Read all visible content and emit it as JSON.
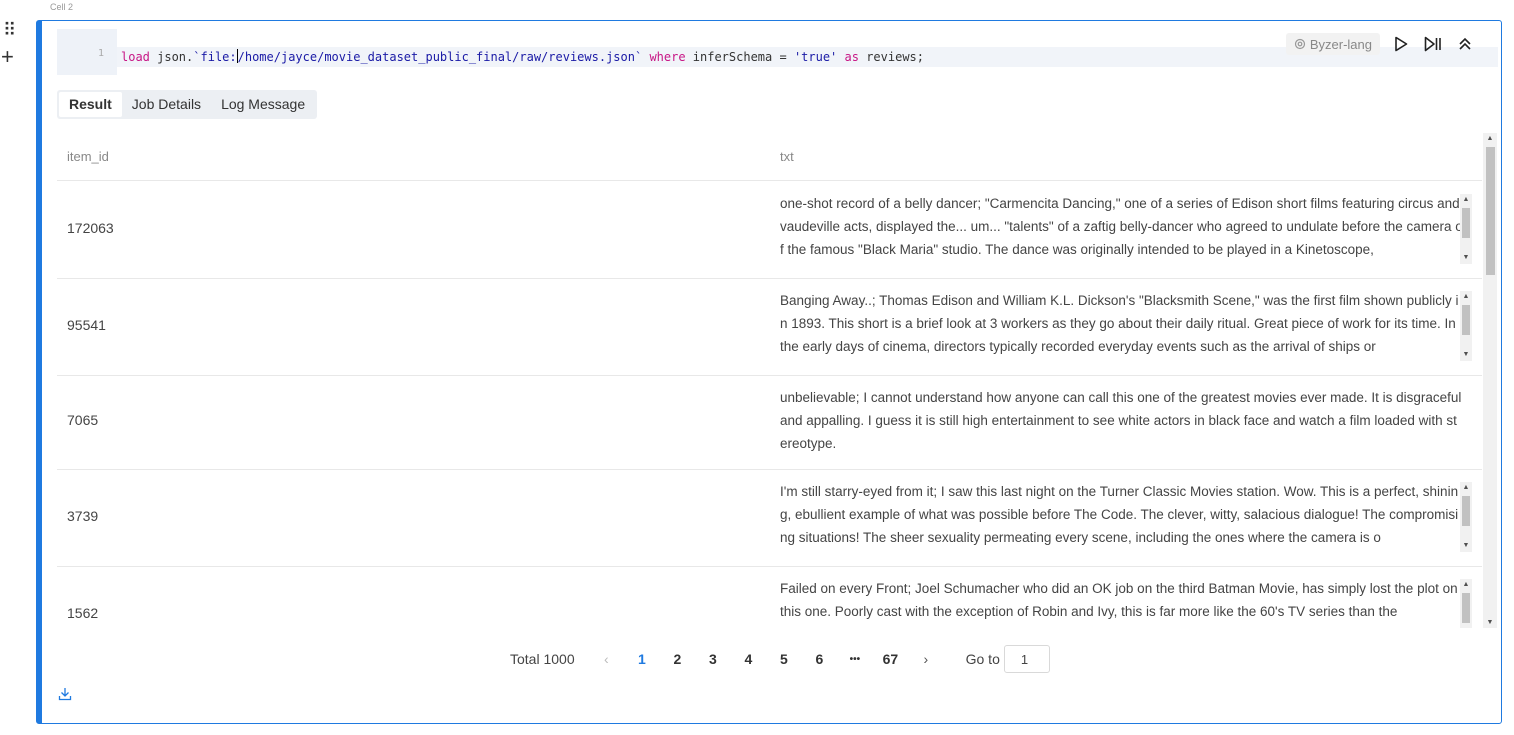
{
  "cell": {
    "label": "Cell 2",
    "drag_glyph": "⠿",
    "add_glyph": "+",
    "language": "Byzer-lang",
    "line_number": "1"
  },
  "code": {
    "t1": "load",
    "t2": " json.",
    "t3": "`file:",
    "t4": "/home/jayce/movie_dataset_public_final/raw/reviews.json`",
    "t5": " ",
    "t6": "where",
    "t7": " inferSchema = ",
    "t8": "'true'",
    "t9": " ",
    "t10": "as",
    "t11": " reviews;"
  },
  "tabs": [
    {
      "label": "Result"
    },
    {
      "label": "Job Details"
    },
    {
      "label": "Log Message"
    }
  ],
  "table": {
    "columns": [
      "item_id",
      "txt"
    ],
    "rows": [
      {
        "item_id": "172063",
        "txt": "one-shot record of a belly dancer; \"Carmencita Dancing,\" one of a series of Edison short films featuring circus and vaudeville acts, displayed the... um... \"talents\" of a zaftig belly-dancer who agreed to undulate before the camera of the famous \"Black Maria\" studio. The dance was originally intended to be played in a Kinetoscope,"
      },
      {
        "item_id": "95541",
        "txt": "Banging Away..; Thomas Edison and William K.L. Dickson's \"Blacksmith Scene,\" was the first film shown publicly in 1893. This short is a brief look at 3 workers as they go about their daily ritual. Great piece of work for its time. In the early days of cinema, directors typically recorded everyday events such as the arrival of ships or"
      },
      {
        "item_id": "7065",
        "txt": "unbelievable; I cannot understand how anyone can call this one of the greatest movies ever made. It is disgraceful and appalling. I guess it is still high entertainment to see white actors in black face and watch a film loaded with stereotype."
      },
      {
        "item_id": "3739",
        "txt": "I'm still starry-eyed from it; I saw this last night on the Turner Classic Movies station. Wow. This is a perfect, shining, ebullient example of what was possible before The Code. The clever, witty, salacious dialogue! The compromising situations! The sheer sexuality permeating every scene, including the ones where the camera is o"
      },
      {
        "item_id": "1562",
        "txt": "Failed on every Front; Joel Schumacher who did an OK job on the third Batman Movie, has simply lost the plot on this one. Poorly cast with the exception of Robin and Ivy, this is far more like the 60's TV series than the"
      }
    ]
  },
  "pagination": {
    "total": "Total 1000",
    "prev_icon": "‹",
    "pages": [
      "1",
      "2",
      "3",
      "4",
      "5",
      "6"
    ],
    "ellipsis": "•••",
    "last": "67",
    "next_icon": "›",
    "goto_label": "Go to",
    "goto_value": "1"
  },
  "colors": {
    "accent": "#1f7ae0",
    "keyword": "#c71585",
    "string": "#1a1aa6"
  }
}
